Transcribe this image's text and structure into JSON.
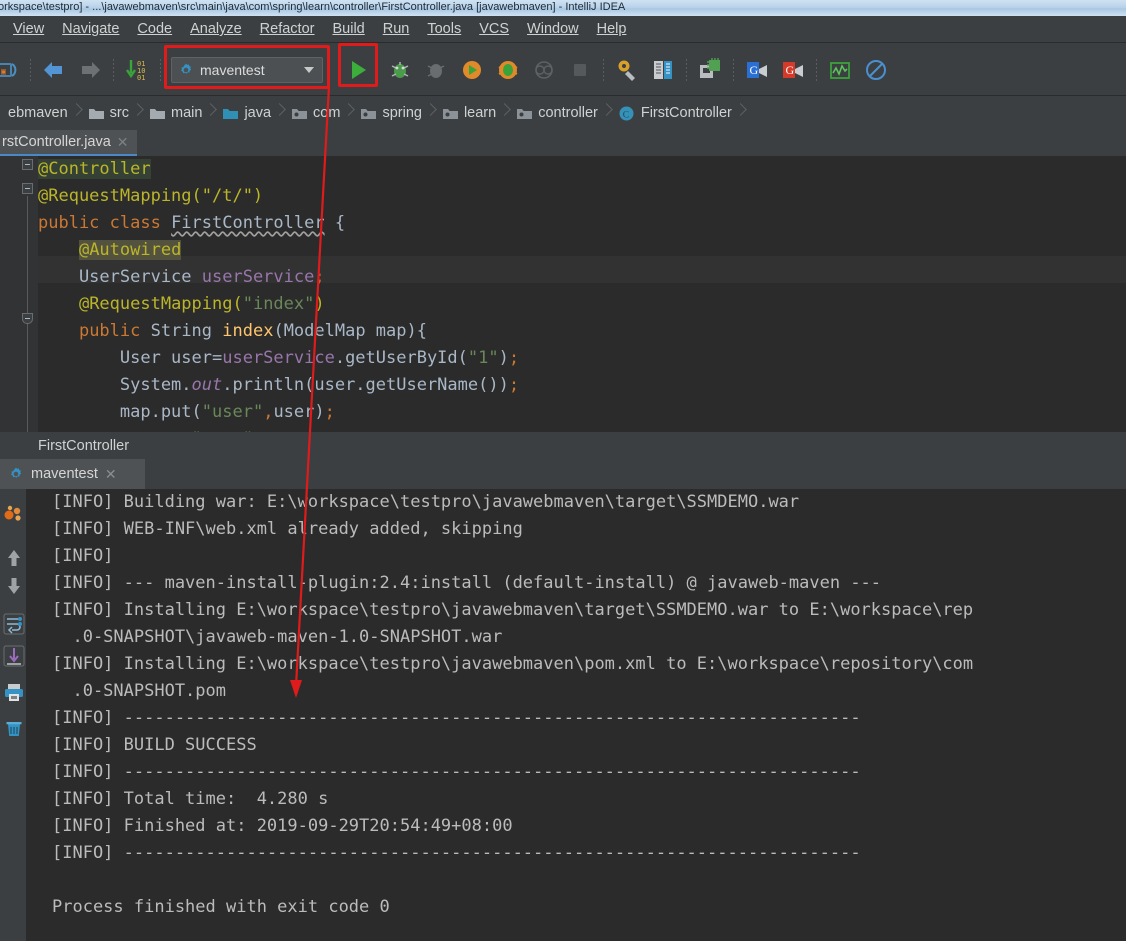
{
  "window": {
    "title": "orkspace\\testpro] - ...\\javawebmaven\\src\\main\\java\\com\\spring\\learn\\controller\\FirstController.java [javawebmaven] - IntelliJ IDEA"
  },
  "menubar": {
    "items": [
      {
        "label": "View",
        "mnemonic_index": 0
      },
      {
        "label": "Navigate",
        "mnemonic_index": 0
      },
      {
        "label": "Code",
        "mnemonic_index": 0
      },
      {
        "label": "Analyze",
        "mnemonic_index": 0
      },
      {
        "label": "Refactor",
        "mnemonic_index": 0
      },
      {
        "label": "Build",
        "mnemonic_index": 0
      },
      {
        "label": "Run",
        "mnemonic_index": 1
      },
      {
        "label": "Tools",
        "mnemonic_index": 0
      },
      {
        "label": "VCS",
        "mnemonic_index": 2
      },
      {
        "label": "Window",
        "mnemonic_index": 0
      },
      {
        "label": "Help",
        "mnemonic_index": 0
      }
    ]
  },
  "toolbar": {
    "run_configuration": {
      "label": "maventest",
      "icon": "gear-icon",
      "dropdown_icon": "chevron-down-icon",
      "highlighted": true
    },
    "icons": [
      "sync-icon",
      "back-arrow-icon",
      "forward-arrow-icon",
      "compile-icon",
      "run-icon",
      "debug-icon",
      "debug-attach-icon",
      "run-coverage-icon",
      "profile-icon",
      "analyze-icon",
      "stop-icon",
      "settings-wrench-icon",
      "project-structure-icon",
      "sdk-manager-icon",
      "google-blue-icon",
      "google-red-icon",
      "monitor-icon",
      "no-entry-icon"
    ],
    "run_button_highlighted": true
  },
  "breadcrumbs": {
    "items": [
      {
        "label": "ebmaven",
        "icon": "module-icon"
      },
      {
        "label": "src",
        "icon": "folder-icon"
      },
      {
        "label": "main",
        "icon": "folder-icon"
      },
      {
        "label": "java",
        "icon": "source-folder-icon"
      },
      {
        "label": "com",
        "icon": "package-icon"
      },
      {
        "label": "spring",
        "icon": "package-icon"
      },
      {
        "label": "learn",
        "icon": "package-icon"
      },
      {
        "label": "controller",
        "icon": "package-icon"
      },
      {
        "label": "FirstController",
        "icon": "class-icon"
      }
    ]
  },
  "editor": {
    "tab": {
      "label": "rstController.java",
      "close_icon": "close-icon"
    },
    "code_lines": [
      "@Controller",
      "@RequestMapping(\"/t/\")",
      "public class FirstController {",
      "    @Autowired",
      "    UserService userService;",
      "    @RequestMapping(\"index\")",
      "    public String index(ModelMap map){",
      "        User user=userService.getUserById(\"1\");",
      "        System.out.println(user.getUserName());",
      "        map.put(\"user\",user);",
      "        return \"test\";"
    ]
  },
  "run_panel": {
    "breadcrumb": "FirstController",
    "tab": {
      "label": "maventest",
      "icon": "gear-icon",
      "close_icon": "close-icon"
    },
    "side_icons": [
      "rerun-icon",
      "up-arrow-icon",
      "down-arrow-icon",
      "soft-wrap-icon",
      "scroll-to-end-icon",
      "print-icon",
      "trash-icon"
    ],
    "console_lines": [
      "[INFO] Building war: E:\\workspace\\testpro\\javawebmaven\\target\\SSMDEMO.war",
      "[INFO] WEB-INF\\web.xml already added, skipping",
      "[INFO]",
      "[INFO] --- maven-install-plugin:2.4:install (default-install) @ javaweb-maven ---",
      "[INFO] Installing E:\\workspace\\testpro\\javawebmaven\\target\\SSMDEMO.war to E:\\workspace\\rep",
      "  .0-SNAPSHOT\\javaweb-maven-1.0-SNAPSHOT.war",
      "[INFO] Installing E:\\workspace\\testpro\\javawebmaven\\pom.xml to E:\\workspace\\repository\\com",
      "  .0-SNAPSHOT.pom",
      "[INFO] ------------------------------------------------------------------------",
      "[INFO] BUILD SUCCESS",
      "[INFO] ------------------------------------------------------------------------",
      "[INFO] Total time:  4.280 s",
      "[INFO] Finished at: 2019-09-29T20:54:49+08:00",
      "[INFO] ------------------------------------------------------------------------",
      "",
      "Process finished with exit code 0"
    ]
  },
  "annotation": {
    "arrow_color": "#e01b1b",
    "highlight_color": "#e01b1b",
    "description": "red arrow from run configuration to console output"
  },
  "colors": {
    "chrome_bg": "#3c3f41",
    "editor_bg": "#2b2b2b",
    "accent_blue": "#4a88c7",
    "annotation_yellow": "#bbb529",
    "keyword_orange": "#cc7832",
    "string_green": "#6a8759",
    "field_purple": "#9876aa",
    "method_gold": "#ffc66d",
    "text_grey": "#a9b7c6"
  }
}
